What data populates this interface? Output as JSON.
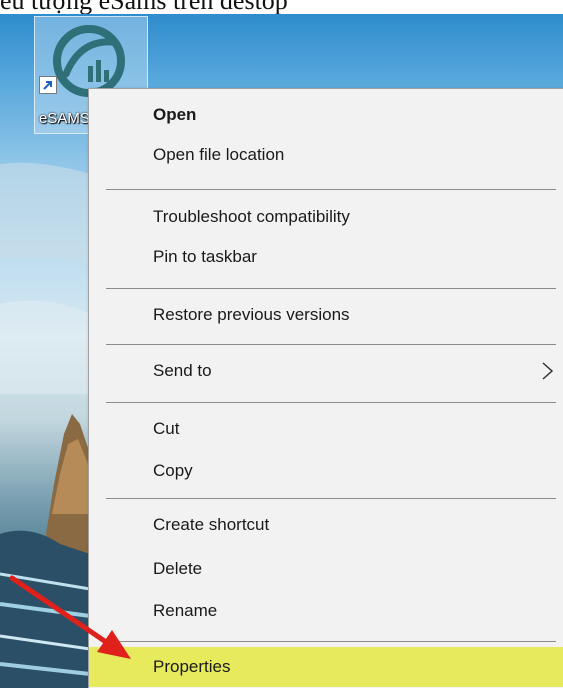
{
  "caption": {
    "text": "ểu tượng eSams trên destop"
  },
  "desktop_icon": {
    "label": "eSAMS"
  },
  "context_menu": {
    "items": [
      {
        "label": "Open"
      },
      {
        "label": "Open file location"
      },
      {
        "label": "Troubleshoot compatibility"
      },
      {
        "label": "Pin to taskbar"
      },
      {
        "label": "Restore previous versions"
      },
      {
        "label": "Send to"
      },
      {
        "label": "Cut"
      },
      {
        "label": "Copy"
      },
      {
        "label": "Create shortcut"
      },
      {
        "label": "Delete"
      },
      {
        "label": "Rename"
      },
      {
        "label": "Properties"
      }
    ],
    "highlighted_item": "Properties",
    "highlight_color": "#e7ea5d"
  },
  "annotation": {
    "arrow_color": "#e0201b",
    "points_to": "Properties"
  },
  "icons": {
    "app_logo": "esams-logo-icon",
    "shortcut_overlay": "shortcut-arrow-icon",
    "submenu": "chevron-right-icon",
    "annotation": "red-arrow-icon"
  }
}
